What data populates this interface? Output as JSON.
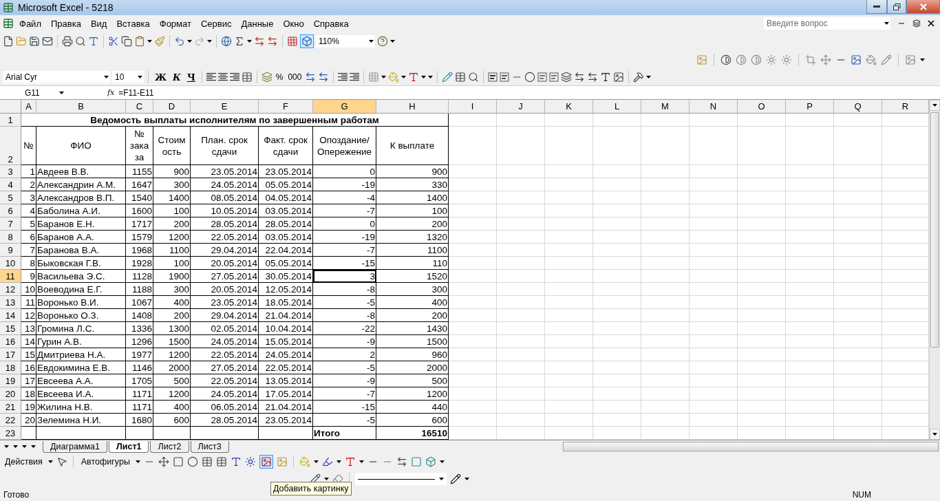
{
  "window": {
    "title": "Microsoft Excel - 5218"
  },
  "menu": [
    "Файл",
    "Правка",
    "Вид",
    "Вставка",
    "Формат",
    "Сервис",
    "Данные",
    "Окно",
    "Справка"
  ],
  "help_box": {
    "placeholder": "Введите вопрос"
  },
  "standard_toolbar": {
    "zoom": "110%"
  },
  "formatting_toolbar": {
    "font": "Arial Cyr",
    "size": "10",
    "bold": "Ж",
    "italic": "К",
    "underline": "Ч",
    "percent": "%",
    "thousands": "000"
  },
  "formula_bar": {
    "name_box": "G11",
    "fx": "fx",
    "formula": "=F11-E11"
  },
  "columns": [
    {
      "label": "A",
      "selected": false
    },
    {
      "label": "B",
      "selected": false
    },
    {
      "label": "C",
      "selected": false
    },
    {
      "label": "D",
      "selected": false
    },
    {
      "label": "E",
      "selected": false
    },
    {
      "label": "F",
      "selected": false
    },
    {
      "label": "G",
      "selected": true
    },
    {
      "label": "H",
      "selected": false
    },
    {
      "label": "I",
      "selected": false
    },
    {
      "label": "J",
      "selected": false
    },
    {
      "label": "K",
      "selected": false
    },
    {
      "label": "L",
      "selected": false
    },
    {
      "label": "M",
      "selected": false
    },
    {
      "label": "N",
      "selected": false
    },
    {
      "label": "O",
      "selected": false
    },
    {
      "label": "P",
      "selected": false
    },
    {
      "label": "Q",
      "selected": false
    },
    {
      "label": "R",
      "selected": false
    }
  ],
  "sheet": {
    "title_row": {
      "label": "1",
      "title": "Ведомость выплаты исполнителям по завершенным работам"
    },
    "header_row": {
      "label": "2",
      "cells": [
        "№",
        "ФИО",
        "№ заказа",
        "Стоимость",
        "План. срок сдачи",
        "Факт. срок сдачи",
        "Опоздание/ Опережение",
        "К выплате"
      ]
    },
    "rows": [
      {
        "label": "3",
        "selected": false,
        "cells": [
          "1",
          "Авдеев В.В.",
          "1155",
          "900",
          "23.05.2014",
          "23.05.2014",
          "0",
          "900"
        ]
      },
      {
        "label": "4",
        "selected": false,
        "cells": [
          "2",
          "Александрин А.М.",
          "1647",
          "300",
          "24.05.2014",
          "05.05.2014",
          "-19",
          "330"
        ]
      },
      {
        "label": "5",
        "selected": false,
        "cells": [
          "3",
          "Александров В.П.",
          "1540",
          "1400",
          "08.05.2014",
          "04.05.2014",
          "-4",
          "1400"
        ]
      },
      {
        "label": "6",
        "selected": false,
        "cells": [
          "4",
          "Баболина А.И.",
          "1600",
          "100",
          "10.05.2014",
          "03.05.2014",
          "-7",
          "100"
        ]
      },
      {
        "label": "7",
        "selected": false,
        "cells": [
          "5",
          "Баранов Е.Н.",
          "1717",
          "200",
          "28.05.2014",
          "28.05.2014",
          "0",
          "200"
        ]
      },
      {
        "label": "8",
        "selected": false,
        "cells": [
          "6",
          "Баранов А.А.",
          "1579",
          "1200",
          "22.05.2014",
          "03.05.2014",
          "-19",
          "1320"
        ]
      },
      {
        "label": "9",
        "selected": false,
        "cells": [
          "7",
          "Баранова В.А.",
          "1968",
          "1100",
          "29.04.2014",
          "22.04.2014",
          "-7",
          "1100"
        ]
      },
      {
        "label": "10",
        "selected": false,
        "cells": [
          "8",
          "Быковская Г.В.",
          "1928",
          "100",
          "20.05.2014",
          "05.05.2014",
          "-15",
          "110"
        ]
      },
      {
        "label": "11",
        "selected": true,
        "cells": [
          "9",
          "Васильева Э.С.",
          "1128",
          "1900",
          "27.05.2014",
          "30.05.2014",
          "3",
          "1520"
        ]
      },
      {
        "label": "12",
        "selected": false,
        "cells": [
          "10",
          "Воеводина Е.Г.",
          "1188",
          "300",
          "20.05.2014",
          "12.05.2014",
          "-8",
          "300"
        ]
      },
      {
        "label": "13",
        "selected": false,
        "cells": [
          "11",
          "Воронько В.И.",
          "1067",
          "400",
          "23.05.2014",
          "18.05.2014",
          "-5",
          "400"
        ]
      },
      {
        "label": "14",
        "selected": false,
        "cells": [
          "12",
          "Воронько О.З.",
          "1408",
          "200",
          "29.04.2014",
          "21.04.2014",
          "-8",
          "200"
        ]
      },
      {
        "label": "15",
        "selected": false,
        "cells": [
          "13",
          "Громина Л.С.",
          "1336",
          "1300",
          "02.05.2014",
          "10.04.2014",
          "-22",
          "1430"
        ]
      },
      {
        "label": "16",
        "selected": false,
        "cells": [
          "14",
          "Гурин А.В.",
          "1296",
          "1500",
          "24.05.2014",
          "15.05.2014",
          "-9",
          "1500"
        ]
      },
      {
        "label": "17",
        "selected": false,
        "cells": [
          "15",
          "Дмитриева Н.А.",
          "1977",
          "1200",
          "22.05.2014",
          "24.05.2014",
          "2",
          "960"
        ]
      },
      {
        "label": "18",
        "selected": false,
        "cells": [
          "16",
          "Евдокимина Е.В.",
          "1146",
          "2000",
          "27.05.2014",
          "22.05.2014",
          "-5",
          "2000"
        ]
      },
      {
        "label": "19",
        "selected": false,
        "cells": [
          "17",
          "Евсеева А.А.",
          "1705",
          "500",
          "22.05.2014",
          "13.05.2014",
          "-9",
          "500"
        ]
      },
      {
        "label": "20",
        "selected": false,
        "cells": [
          "18",
          "Евсеева И.А.",
          "1171",
          "1200",
          "24.05.2014",
          "17.05.2014",
          "-7",
          "1200"
        ]
      },
      {
        "label": "21",
        "selected": false,
        "cells": [
          "19",
          "Жилина Н.В.",
          "1171",
          "400",
          "06.05.2014",
          "21.04.2014",
          "-15",
          "440"
        ]
      },
      {
        "label": "22",
        "selected": false,
        "cells": [
          "20",
          "Зелемина Н.И.",
          "1680",
          "600",
          "28.05.2014",
          "23.05.2014",
          "-5",
          "600"
        ]
      }
    ],
    "total_row": {
      "label": "23",
      "caption": "Итого",
      "sum": "16510"
    }
  },
  "sheet_tabs": [
    {
      "label": "Диаграмма1",
      "selected": false
    },
    {
      "label": "Лист1",
      "selected": true
    },
    {
      "label": "Лист2",
      "selected": false
    },
    {
      "label": "Лист3",
      "selected": false
    }
  ],
  "drawing_toolbar": {
    "actions": "Действия",
    "autoshapes": "Автофигуры"
  },
  "tooltip": "Добавить картинку",
  "status_bar": {
    "state": "Готово",
    "num": "NUM"
  }
}
